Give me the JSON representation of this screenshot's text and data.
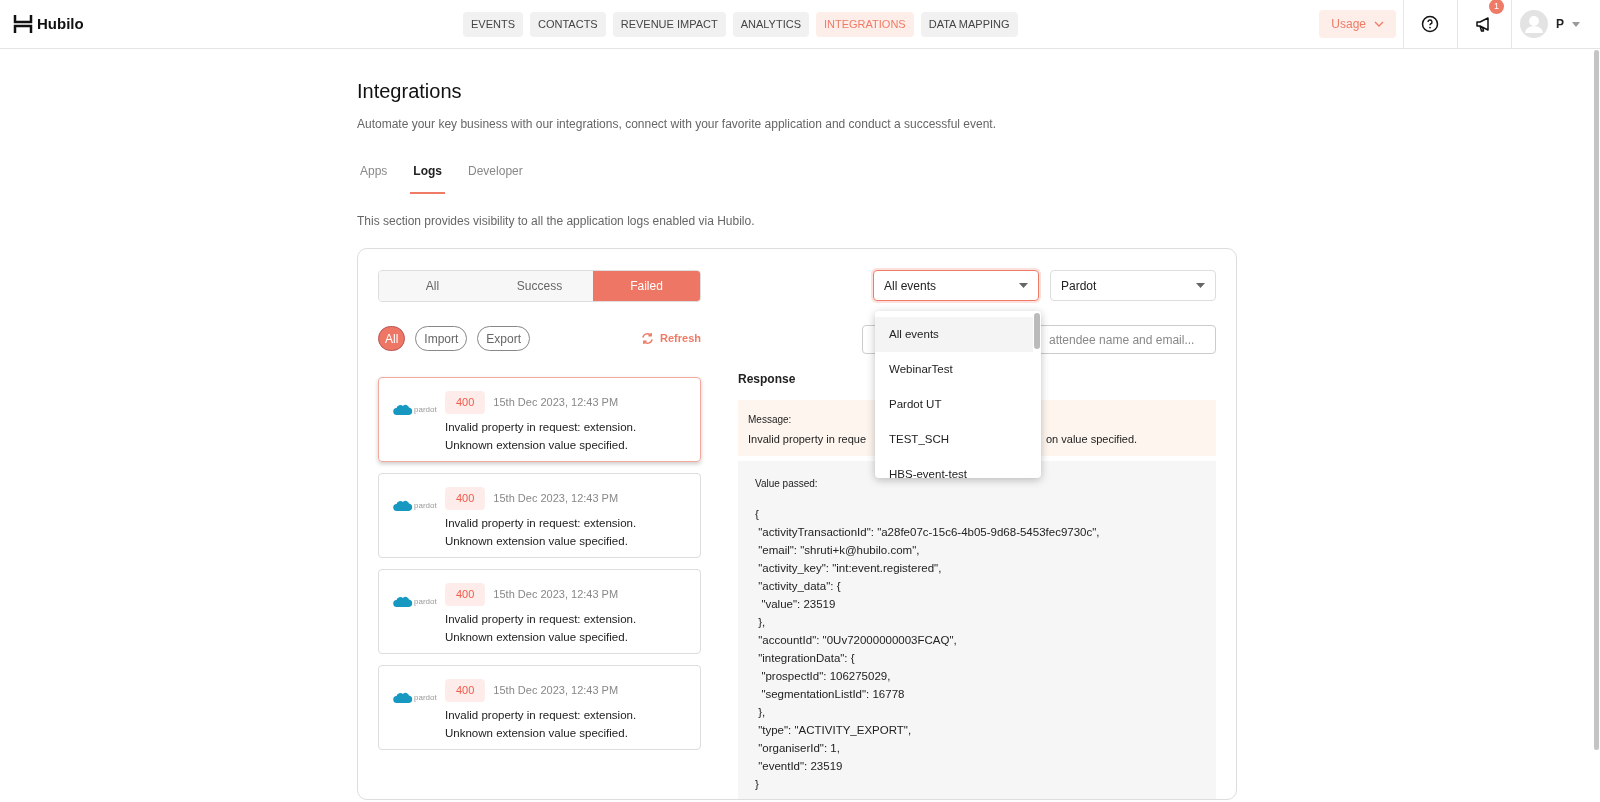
{
  "header": {
    "logo_text": "Hubilo",
    "nav": [
      {
        "label": "EVENTS",
        "selected": false
      },
      {
        "label": "CONTACTS",
        "selected": false
      },
      {
        "label": "REVENUE IMPACT",
        "selected": false
      },
      {
        "label": "ANALYTICS",
        "selected": false
      },
      {
        "label": "INTEGRATIONS",
        "selected": true
      },
      {
        "label": "DATA MAPPING",
        "selected": false
      }
    ],
    "usage_button": "Usage",
    "notification_badge": "1",
    "user_initial": "P"
  },
  "page": {
    "title": "Integrations",
    "subtitle": "Automate your key business with our integrations, connect with your favorite application and conduct a successful event.",
    "tabs": [
      {
        "label": "Apps",
        "selected": false
      },
      {
        "label": "Logs",
        "selected": true
      },
      {
        "label": "Developer",
        "selected": false
      }
    ],
    "section_description": "This section provides visibility to all the application logs enabled via Hubilo."
  },
  "logs": {
    "status_filter": [
      {
        "label": "All",
        "selected": false
      },
      {
        "label": "Success",
        "selected": false
      },
      {
        "label": "Failed",
        "selected": true
      }
    ],
    "type_filter": [
      {
        "label": "All",
        "selected": true
      },
      {
        "label": "Import",
        "selected": false
      },
      {
        "label": "Export",
        "selected": false
      }
    ],
    "refresh": "Refresh",
    "entries": [
      {
        "logo_text": "pardot",
        "code": "400",
        "time": "15th Dec 2023, 12:43 PM",
        "message": "Invalid property in request: extension. Unknown extension value specified.",
        "selected": true
      },
      {
        "logo_text": "pardot",
        "code": "400",
        "time": "15th Dec 2023, 12:43 PM",
        "message": "Invalid property in request: extension. Unknown extension value specified.",
        "selected": false
      },
      {
        "logo_text": "pardot",
        "code": "400",
        "time": "15th Dec 2023, 12:43 PM",
        "message": "Invalid property in request: extension. Unknown extension value specified.",
        "selected": false
      },
      {
        "logo_text": "pardot",
        "code": "400",
        "time": "15th Dec 2023, 12:43 PM",
        "message": "Invalid property in request: extension. Unknown extension value specified.",
        "selected": false
      }
    ]
  },
  "detail": {
    "event_select": {
      "value": "All events",
      "expanded": true,
      "options": [
        {
          "label": "All events",
          "selected": true
        },
        {
          "label": "WebinarTest",
          "selected": false
        },
        {
          "label": "Pardot UT",
          "selected": false
        },
        {
          "label": "TEST_SCH",
          "selected": false
        },
        {
          "label": "HBS-event-test",
          "selected": false
        }
      ]
    },
    "app_select": {
      "value": "Pardot"
    },
    "search": {
      "placeholder": "attendee name and email..."
    },
    "response_label": "Response",
    "message_label": "Message:",
    "message_parts": [
      "Invalid property in reque",
      "on value specified."
    ],
    "value_label": "Value passed:",
    "value_lines": [
      "{",
      " \"activityTransactionId\": \"a28fe07c-15c6-4b05-9d68-5453fec9730c\",",
      " \"email\": \"shruti+k@hubilo.com\",",
      " \"activity_key\": \"int:event.registered\",",
      " \"activity_data\": {",
      "  \"value\": 23519",
      " },",
      " \"accountId\": \"0Uv72000000003FCAQ\",",
      " \"integrationData\": {",
      "  \"prospectId\": 106275029,",
      "  \"segmentationListId\": 16778",
      " },",
      " \"type\": \"ACTIVITY_EXPORT\",",
      " \"organiserId\": 1,",
      " \"eventId\": 23519",
      "}"
    ]
  }
}
